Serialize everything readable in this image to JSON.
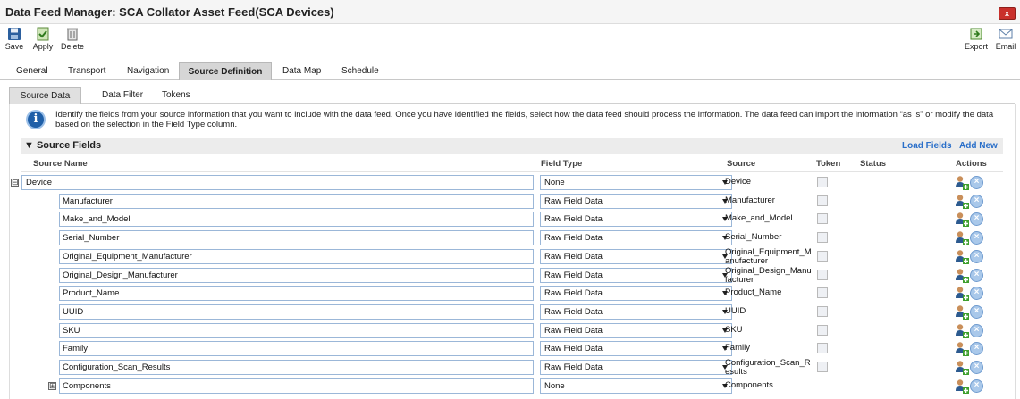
{
  "window": {
    "title": "Data Feed Manager: SCA Collator Asset Feed(SCA Devices)",
    "close_label": "x"
  },
  "toolbar": {
    "save": "Save",
    "apply": "Apply",
    "delete": "Delete",
    "export": "Export",
    "email": "Email"
  },
  "tabs": [
    "General",
    "Transport",
    "Navigation",
    "Source Definition",
    "Data Map",
    "Schedule"
  ],
  "active_tab": "Source Definition",
  "subtabs": [
    "Source Data",
    "Data Filter",
    "Tokens"
  ],
  "active_subtab": "Source Data",
  "info": {
    "text": "Identify the fields from your source information that you want to include with the data feed. Once you have identified the fields, select how the data feed should process the information. The data feed can import the information “as is” or modify the data based on the selection in the Field Type column."
  },
  "section": {
    "title": "Source Fields",
    "load_fields": "Load Fields",
    "add_new": "Add New"
  },
  "columns": {
    "source_name": "Source Name",
    "field_type": "Field Type",
    "source": "Source",
    "token": "Token",
    "status": "Status",
    "actions": "Actions"
  },
  "rows": [
    {
      "expander": "⊟",
      "name": "Device",
      "field_type": "None",
      "source": "Device",
      "token": false
    },
    {
      "name": "Manufacturer",
      "field_type": "Raw Field Data",
      "source": "Manufacturer",
      "token": false
    },
    {
      "name": "Make_and_Model",
      "field_type": "Raw Field Data",
      "source": "Make_and_Model",
      "token": false
    },
    {
      "name": "Serial_Number",
      "field_type": "Raw Field Data",
      "source": "Serial_Number",
      "token": false
    },
    {
      "name": "Original_Equipment_Manufacturer",
      "field_type": "Raw Field Data",
      "source": "Original_Equipment_M anufacturer",
      "token": false
    },
    {
      "name": "Original_Design_Manufacturer",
      "field_type": "Raw Field Data",
      "source": "Original_Design_Manu facturer",
      "token": false
    },
    {
      "name": "Product_Name",
      "field_type": "Raw Field Data",
      "source": "Product_Name",
      "token": false
    },
    {
      "name": "UUID",
      "field_type": "Raw Field Data",
      "source": "UUID",
      "token": false
    },
    {
      "name": "SKU",
      "field_type": "Raw Field Data",
      "source": "SKU",
      "token": false
    },
    {
      "name": "Family",
      "field_type": "Raw Field Data",
      "source": "Family",
      "token": false
    },
    {
      "name": "Configuration_Scan_Results",
      "field_type": "Raw Field Data",
      "source": "Configuration_Scan_R esults",
      "token": false
    },
    {
      "expander": "⊞",
      "name": "Components",
      "field_type": "None",
      "source": "Components"
    }
  ]
}
